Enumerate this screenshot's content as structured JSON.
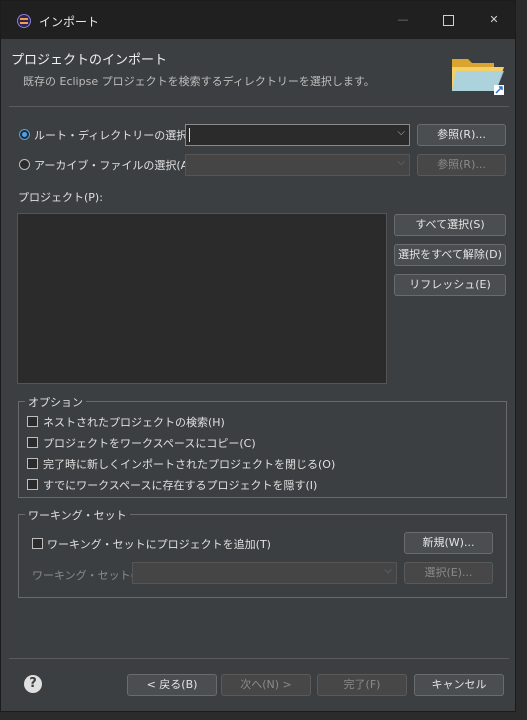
{
  "window": {
    "title": "インポート",
    "minimize": "—",
    "close": "✕"
  },
  "header": {
    "title": "プロジェクトのインポート",
    "description": "既存の Eclipse プロジェクトを検索するディレクトリーを選択します。"
  },
  "source": {
    "root_dir_label": "ルート・ディレクトリーの選択(T):",
    "root_dir_value": "",
    "root_browse": "参照(R)...",
    "archive_label": "アーカイブ・ファイルの選択(A):",
    "archive_value": "",
    "archive_browse": "参照(R)..."
  },
  "projects": {
    "label": "プロジェクト(P):",
    "items": [],
    "select_all": "すべて選択(S)",
    "deselect_all": "選択をすべて解除(D)",
    "refresh": "リフレッシュ(E)"
  },
  "options": {
    "title": "オプション",
    "items": [
      {
        "label": "ネストされたプロジェクトの検索(H)",
        "checked": false
      },
      {
        "label": "プロジェクトをワークスペースにコピー(C)",
        "checked": false
      },
      {
        "label": "完了時に新しくインポートされたプロジェクトを閉じる(O)",
        "checked": false
      },
      {
        "label": "すでにワークスペースに存在するプロジェクトを隠す(I)",
        "checked": false
      }
    ]
  },
  "working_set": {
    "title": "ワーキング・セット",
    "add_label": "ワーキング・セットにプロジェクトを追加(T)",
    "add_checked": false,
    "new_button": "新規(W)...",
    "set_label": "ワーキング・セット(O):",
    "set_value": "",
    "select_button": "選択(E)..."
  },
  "footer": {
    "help": "?",
    "back": "< 戻る(B)",
    "next": "次へ(N) >",
    "finish": "完了(F)",
    "cancel": "キャンセル"
  },
  "colors": {
    "accent": "#4aa3f0",
    "background": "#3c3f41",
    "titlebar": "#202020"
  }
}
